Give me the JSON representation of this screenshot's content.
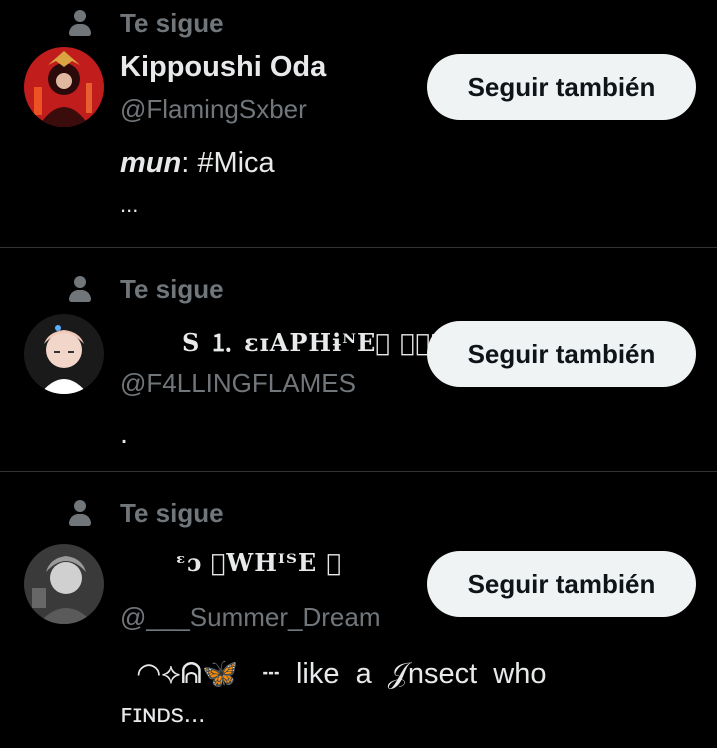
{
  "users": [
    {
      "follows_you": "Te sigue",
      "name": "Kippoushi Oda",
      "handle": "@FlamingSxber",
      "button": "Seguir también",
      "bio_prefix": "mun",
      "bio_rest": ": #Mica",
      "bio_line2": "...",
      "avatar_colors": [
        "#c21d1d",
        "#3a0c0c",
        "#d9a441"
      ]
    },
    {
      "follows_you": "Te sigue",
      "name": "S ⒈ εɪAPHɨᴺE⃞ ⌜✶⌟",
      "handle": "@F4LLINGFLAMES",
      "button": "Seguir también",
      "bio_line1": ".",
      "avatar_colors": [
        "#1a1a1a",
        "#f2d6c9",
        "#ffffff"
      ]
    },
    {
      "follows_you": "Te sigue",
      "name": "ᵋɔ      ᪶WHᴵᵀE  ⋯",
      "handle": "@___Summer_Dream",
      "button": "Seguir también",
      "bio_line1": "  ◠⟡ᕱ🦋   ┄  like  a  𝒥nsect  who",
      "bio_line2": "ꜰɪɴᴅs...",
      "avatar_colors": [
        "#3a3a3a",
        "#9a9a9a",
        "#d0d0d0"
      ]
    }
  ],
  "colors": {
    "background": "#000000",
    "text_primary": "#e7e9ea",
    "text_secondary": "#71767b",
    "button_bg": "#eff3f4",
    "button_text": "#0f1419",
    "divider": "#2f3336"
  },
  "icons": {
    "follows_you": "person-icon"
  }
}
